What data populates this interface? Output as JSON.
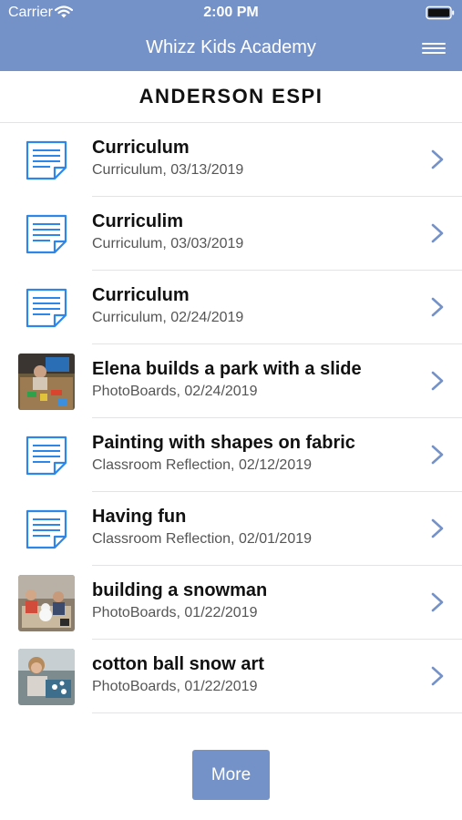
{
  "status_bar": {
    "carrier": "Carrier",
    "time": "2:00 PM"
  },
  "nav": {
    "title": "Whizz Kids Academy",
    "menu_icon": "hamburger-menu-icon"
  },
  "header": {
    "name": "ANDERSON ESPI"
  },
  "colors": {
    "brand": "#7592c8",
    "icon_blue": "#2e86e8",
    "chevron": "#7592c8",
    "subtitle": "#555555"
  },
  "items": [
    {
      "title": "Curriculum",
      "subtitle": "Curriculum, 03/13/2019",
      "icon": "document-icon"
    },
    {
      "title": "Curriculim",
      "subtitle": "Curriculum, 03/03/2019",
      "icon": "document-icon"
    },
    {
      "title": "Curriculum",
      "subtitle": "Curriculum, 02/24/2019",
      "icon": "document-icon"
    },
    {
      "title": "Elena builds a park with a slide",
      "subtitle": "PhotoBoards, 02/24/2019",
      "icon": "photo-thumbnail"
    },
    {
      "title": "Painting with shapes on fabric",
      "subtitle": "Classroom Reflection, 02/12/2019",
      "icon": "document-icon"
    },
    {
      "title": "Having fun",
      "subtitle": "Classroom Reflection, 02/01/2019",
      "icon": "document-icon"
    },
    {
      "title": "building a snowman",
      "subtitle": "PhotoBoards, 01/22/2019",
      "icon": "photo-thumbnail"
    },
    {
      "title": "cotton ball snow art",
      "subtitle": "PhotoBoards, 01/22/2019",
      "icon": "photo-thumbnail"
    }
  ],
  "more_button": {
    "label": "More"
  }
}
